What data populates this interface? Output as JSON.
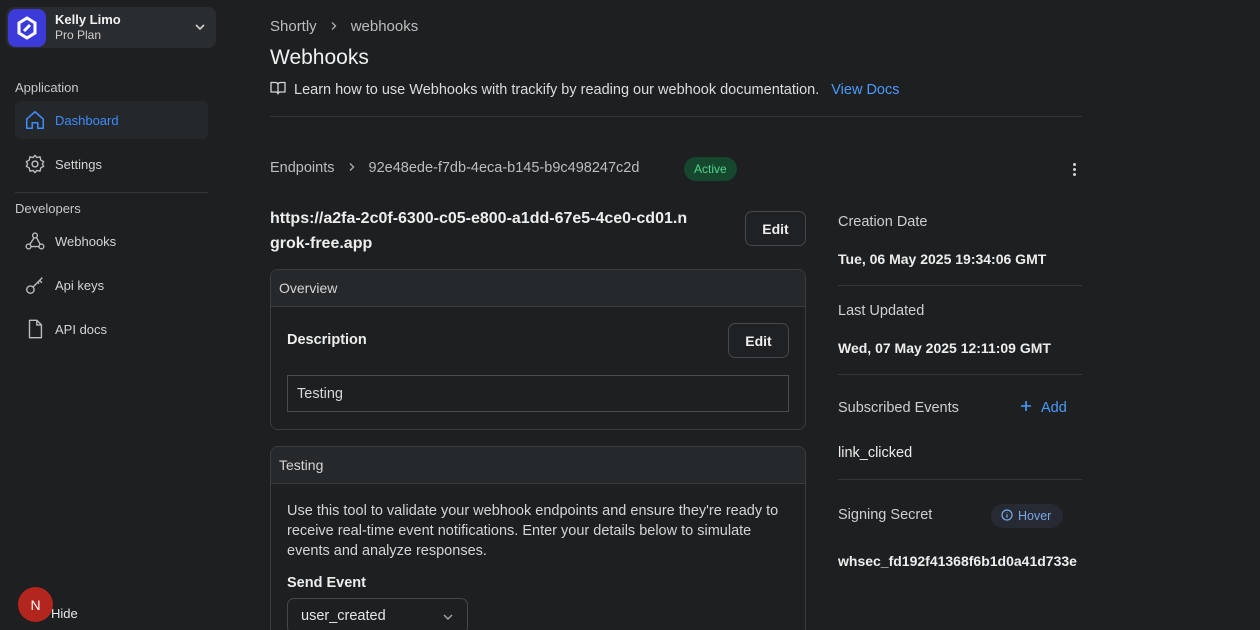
{
  "profile": {
    "name": "Kelly Limo",
    "plan": "Pro Plan"
  },
  "sidebar": {
    "section_application": "Application",
    "section_developers": "Developers",
    "items": [
      {
        "label": "Dashboard",
        "icon": "home-icon",
        "active": true
      },
      {
        "label": "Settings",
        "icon": "gear-icon"
      },
      {
        "label": "Webhooks",
        "icon": "webhook-icon"
      },
      {
        "label": "Api keys",
        "icon": "key-icon"
      },
      {
        "label": "API docs",
        "icon": "document-icon"
      }
    ],
    "avatar_initial": "N",
    "hide_label": "Hide"
  },
  "breadcrumb": {
    "root": "Shortly",
    "current": "webhooks"
  },
  "page": {
    "title": "Webhooks",
    "docs_text": "Learn how to use Webhooks with trackify by reading our webhook documentation.",
    "docs_link": "View Docs"
  },
  "endpoint": {
    "crumb_root": "Endpoints",
    "id": "92e48ede-f7db-4eca-b145-b9c498247c2d",
    "status": "Active",
    "url": "https://a2fa-2c0f-6300-c05-e800-a1dd-67e5-4ce0-cd01.ngrok-free.app",
    "edit_label": "Edit"
  },
  "overview": {
    "header": "Overview",
    "description_label": "Description",
    "edit_label": "Edit",
    "description_value": "Testing"
  },
  "testing": {
    "header": "Testing",
    "text": "Use this tool to validate your webhook endpoints and ensure they're ready to receive real-time event notifications. Enter your details below to simulate events and analyze responses.",
    "send_label": "Send Event",
    "selected_event": "user_created"
  },
  "details": {
    "creation_label": "Creation Date",
    "creation_value": "Tue, 06 May 2025 19:34:06 GMT",
    "updated_label": "Last Updated",
    "updated_value": "Wed, 07 May 2025 12:11:09 GMT",
    "events_label": "Subscribed Events",
    "add_label": "Add",
    "event_value": "link_clicked",
    "secret_label": "Signing Secret",
    "hover_label": "Hover",
    "secret_value": "whsec_fd192f41368f6b1d0a41d733e"
  },
  "colors": {
    "accent": "#4b9bff",
    "active_green": "#4fd38a",
    "avatar_red": "#b3261e",
    "logo_blue": "#3b3bd9"
  }
}
